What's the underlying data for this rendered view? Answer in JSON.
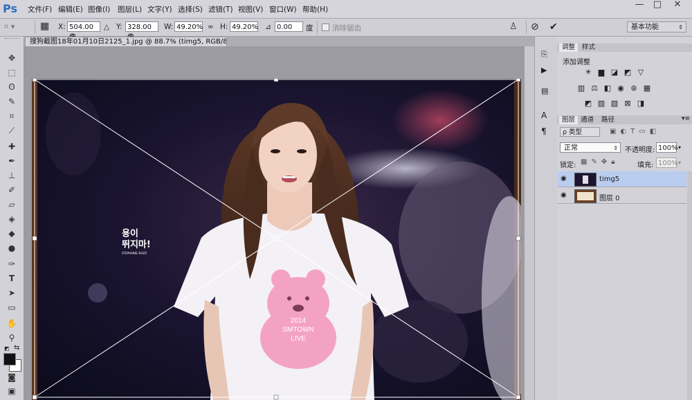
{
  "app": {
    "logo": "Ps"
  },
  "menu": [
    "文件(F)",
    "编辑(E)",
    "图像(I)",
    "图层(L)",
    "文字(Y)",
    "选择(S)",
    "滤镜(T)",
    "视图(V)",
    "窗口(W)",
    "帮助(H)"
  ],
  "window_controls": {
    "minimize": "—",
    "restore": "□",
    "close": "✕"
  },
  "options": {
    "x_label": "X:",
    "x_value": "504.00 像",
    "y_label": "Y:",
    "y_value": "328.00 像",
    "w_label": "W:",
    "w_value": "49.20%",
    "h_label": "H:",
    "h_value": "49.20%",
    "angle_value": "0.00",
    "angle_unit": "度",
    "antialias_label": "消除锯齿",
    "workspace": "基本功能"
  },
  "document": {
    "tab_title": "搜狗截图18年01月10日2125_1.jpg @ 88.7% (timg5, RGB/8#) *",
    "close": "×"
  },
  "photo": {
    "watermark_line1": "용이",
    "watermark_line2": "뛰지마!",
    "watermark_small": "STEPHANIE∙ROZZ",
    "shirt_year": "2014",
    "shirt_brand": "SMTOWN",
    "shirt_event": "LIVE"
  },
  "adjustments": {
    "tab_adjust": "调整",
    "tab_style": "样式",
    "add_label": "添加调整"
  },
  "layers_panel": {
    "tabs": [
      "图层",
      "通道",
      "路径"
    ],
    "filter_kind": "ρ 类型",
    "blend_mode": "正常",
    "opacity_label": "不透明度:",
    "opacity_value": "100%",
    "lock_label": "锁定:",
    "fill_label": "填充:",
    "fill_value": "100%",
    "layers": [
      {
        "name": "timg5",
        "selected": true
      },
      {
        "name": "图层 0",
        "selected": false
      }
    ]
  },
  "colors": {
    "accent": "#2d6fb9",
    "selected_layer": "#b9cdf0",
    "panel_bg": "#d3d2d9"
  }
}
